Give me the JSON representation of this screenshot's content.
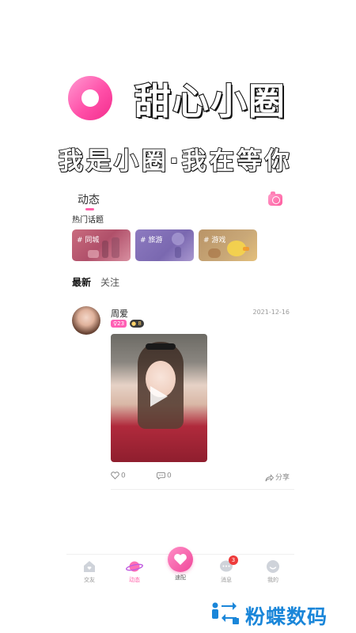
{
  "promo": {
    "brand_title": "甜心小圈",
    "slogan": "我是小圈·我在等你"
  },
  "header": {
    "tab_label": "动态",
    "camera_icon": "camera-icon"
  },
  "topics": {
    "title": "热门话题",
    "items": [
      {
        "label": "# 同城"
      },
      {
        "label": "# 旅游"
      },
      {
        "label": "# 游戏"
      }
    ]
  },
  "feed_tabs": [
    {
      "label": "最新",
      "active": true
    },
    {
      "label": "关注",
      "active": false
    }
  ],
  "post": {
    "username": "周爱",
    "date": "2021-12-16",
    "badge_pink": "♀23",
    "badge_dark": "● 8",
    "likes": "0",
    "comments": "0",
    "share_label": "分享"
  },
  "tabbar": {
    "items": [
      {
        "label": "交友",
        "icon": "home-icon"
      },
      {
        "label": "动态",
        "icon": "planet-icon",
        "active": true
      },
      {
        "label": "速配",
        "icon": "heart-icon"
      },
      {
        "label": "消息",
        "icon": "chat-icon",
        "badge": "3"
      },
      {
        "label": "我的",
        "icon": "profile-icon"
      }
    ]
  },
  "watermark": {
    "text": "粉蝶数码"
  },
  "colors": {
    "accent": "#ff5fa8",
    "badge_red": "#ee3b3b",
    "watermark_blue": "#1a86d9"
  }
}
